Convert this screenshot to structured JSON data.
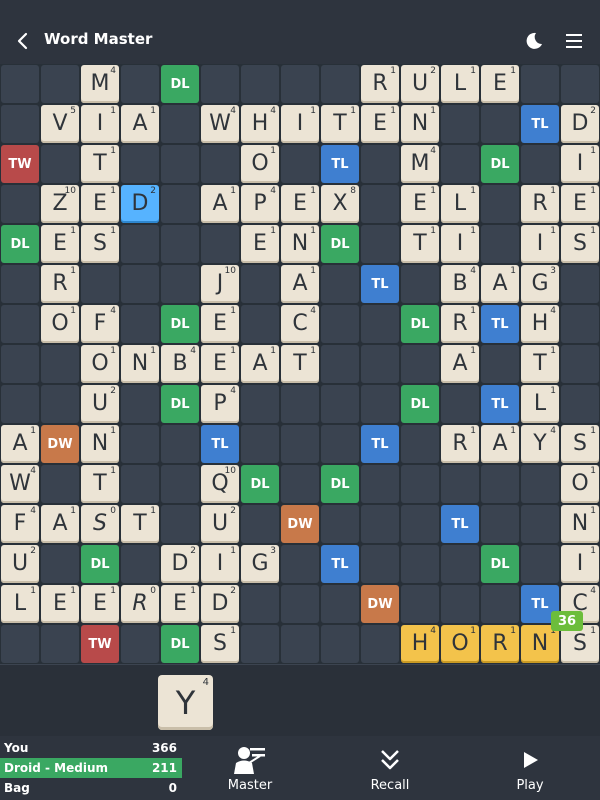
{
  "header": {
    "title": "Word Master",
    "back_icon": "chevron-left-icon",
    "theme_icon": "moon-icon",
    "menu_icon": "hamburger-menu-icon"
  },
  "board": {
    "size": 15,
    "colors": {
      "DL": "#3aa862",
      "TL": "#3f7fd0",
      "DW": "#c8794a",
      "TW": "#b84a4a",
      "tile": "#ece4d5",
      "new_tile": "#f3c34b",
      "last_tile": "#56b3ff",
      "empty": "#3a4350"
    },
    "tiles": [
      {
        "r": 0,
        "c": 2,
        "l": "M",
        "p": 4
      },
      {
        "r": 0,
        "c": 9,
        "l": "R",
        "p": 1
      },
      {
        "r": 0,
        "c": 10,
        "l": "U",
        "p": 2
      },
      {
        "r": 0,
        "c": 11,
        "l": "L",
        "p": 1
      },
      {
        "r": 0,
        "c": 12,
        "l": "E",
        "p": 1
      },
      {
        "r": 1,
        "c": 1,
        "l": "V",
        "p": 5
      },
      {
        "r": 1,
        "c": 2,
        "l": "I",
        "p": 1
      },
      {
        "r": 1,
        "c": 3,
        "l": "A",
        "p": 1
      },
      {
        "r": 1,
        "c": 5,
        "l": "W",
        "p": 4
      },
      {
        "r": 1,
        "c": 6,
        "l": "H",
        "p": 4
      },
      {
        "r": 1,
        "c": 7,
        "l": "I",
        "p": 1
      },
      {
        "r": 1,
        "c": 8,
        "l": "T",
        "p": 1
      },
      {
        "r": 1,
        "c": 9,
        "l": "E",
        "p": 1
      },
      {
        "r": 1,
        "c": 10,
        "l": "N",
        "p": 1
      },
      {
        "r": 1,
        "c": 14,
        "l": "D",
        "p": 2
      },
      {
        "r": 2,
        "c": 2,
        "l": "T",
        "p": 1
      },
      {
        "r": 2,
        "c": 6,
        "l": "O",
        "p": 1
      },
      {
        "r": 2,
        "c": 10,
        "l": "M",
        "p": 4
      },
      {
        "r": 2,
        "c": 14,
        "l": "I",
        "p": 1
      },
      {
        "r": 3,
        "c": 1,
        "l": "Z",
        "p": 10
      },
      {
        "r": 3,
        "c": 2,
        "l": "E",
        "p": 1
      },
      {
        "r": 3,
        "c": 3,
        "l": "D",
        "p": 2,
        "last": true
      },
      {
        "r": 3,
        "c": 5,
        "l": "A",
        "p": 1
      },
      {
        "r": 3,
        "c": 6,
        "l": "P",
        "p": 4
      },
      {
        "r": 3,
        "c": 7,
        "l": "E",
        "p": 1
      },
      {
        "r": 3,
        "c": 8,
        "l": "X",
        "p": 8
      },
      {
        "r": 3,
        "c": 10,
        "l": "E",
        "p": 1
      },
      {
        "r": 3,
        "c": 11,
        "l": "L",
        "p": 1
      },
      {
        "r": 3,
        "c": 13,
        "l": "R",
        "p": 1
      },
      {
        "r": 3,
        "c": 14,
        "l": "E",
        "p": 1
      },
      {
        "r": 4,
        "c": 1,
        "l": "E",
        "p": 1
      },
      {
        "r": 4,
        "c": 2,
        "l": "S",
        "p": 1
      },
      {
        "r": 4,
        "c": 6,
        "l": "E",
        "p": 1
      },
      {
        "r": 4,
        "c": 7,
        "l": "N",
        "p": 1
      },
      {
        "r": 4,
        "c": 10,
        "l": "T",
        "p": 1
      },
      {
        "r": 4,
        "c": 11,
        "l": "I",
        "p": 1
      },
      {
        "r": 4,
        "c": 13,
        "l": "I",
        "p": 1
      },
      {
        "r": 4,
        "c": 14,
        "l": "S",
        "p": 1
      },
      {
        "r": 5,
        "c": 1,
        "l": "R",
        "p": 1
      },
      {
        "r": 5,
        "c": 5,
        "l": "J",
        "p": 10
      },
      {
        "r": 5,
        "c": 7,
        "l": "A",
        "p": 1
      },
      {
        "r": 5,
        "c": 11,
        "l": "B",
        "p": 4
      },
      {
        "r": 5,
        "c": 12,
        "l": "A",
        "p": 1
      },
      {
        "r": 5,
        "c": 13,
        "l": "G",
        "p": 3
      },
      {
        "r": 6,
        "c": 1,
        "l": "O",
        "p": 1
      },
      {
        "r": 6,
        "c": 2,
        "l": "F",
        "p": 4
      },
      {
        "r": 6,
        "c": 5,
        "l": "E",
        "p": 1
      },
      {
        "r": 6,
        "c": 7,
        "l": "C",
        "p": 4
      },
      {
        "r": 6,
        "c": 11,
        "l": "R",
        "p": 1
      },
      {
        "r": 6,
        "c": 13,
        "l": "H",
        "p": 4
      },
      {
        "r": 7,
        "c": 2,
        "l": "O",
        "p": 1
      },
      {
        "r": 7,
        "c": 3,
        "l": "N",
        "p": 1
      },
      {
        "r": 7,
        "c": 4,
        "l": "B",
        "p": 4
      },
      {
        "r": 7,
        "c": 5,
        "l": "E",
        "p": 1
      },
      {
        "r": 7,
        "c": 6,
        "l": "A",
        "p": 1
      },
      {
        "r": 7,
        "c": 7,
        "l": "T",
        "p": 1
      },
      {
        "r": 7,
        "c": 11,
        "l": "A",
        "p": 1
      },
      {
        "r": 7,
        "c": 13,
        "l": "T",
        "p": 1
      },
      {
        "r": 8,
        "c": 2,
        "l": "U",
        "p": 2
      },
      {
        "r": 8,
        "c": 5,
        "l": "P",
        "p": 4
      },
      {
        "r": 8,
        "c": 13,
        "l": "L",
        "p": 1
      },
      {
        "r": 9,
        "c": 0,
        "l": "A",
        "p": 1
      },
      {
        "r": 9,
        "c": 2,
        "l": "N",
        "p": 1
      },
      {
        "r": 9,
        "c": 11,
        "l": "R",
        "p": 1
      },
      {
        "r": 9,
        "c": 12,
        "l": "A",
        "p": 1
      },
      {
        "r": 9,
        "c": 13,
        "l": "Y",
        "p": 4
      },
      {
        "r": 9,
        "c": 14,
        "l": "S",
        "p": 1
      },
      {
        "r": 10,
        "c": 0,
        "l": "W",
        "p": 4
      },
      {
        "r": 10,
        "c": 2,
        "l": "T",
        "p": 1
      },
      {
        "r": 10,
        "c": 5,
        "l": "Q",
        "p": 10
      },
      {
        "r": 10,
        "c": 14,
        "l": "O",
        "p": 1
      },
      {
        "r": 11,
        "c": 0,
        "l": "F",
        "p": 4
      },
      {
        "r": 11,
        "c": 1,
        "l": "A",
        "p": 1
      },
      {
        "r": 11,
        "c": 2,
        "l": "S",
        "p": 0,
        "blank": true
      },
      {
        "r": 11,
        "c": 3,
        "l": "T",
        "p": 1
      },
      {
        "r": 11,
        "c": 5,
        "l": "U",
        "p": 2
      },
      {
        "r": 11,
        "c": 14,
        "l": "N",
        "p": 1
      },
      {
        "r": 12,
        "c": 0,
        "l": "U",
        "p": 2
      },
      {
        "r": 12,
        "c": 4,
        "l": "D",
        "p": 2
      },
      {
        "r": 12,
        "c": 5,
        "l": "I",
        "p": 1
      },
      {
        "r": 12,
        "c": 6,
        "l": "G",
        "p": 3
      },
      {
        "r": 12,
        "c": 14,
        "l": "I",
        "p": 1
      },
      {
        "r": 13,
        "c": 0,
        "l": "L",
        "p": 1
      },
      {
        "r": 13,
        "c": 1,
        "l": "E",
        "p": 1
      },
      {
        "r": 13,
        "c": 2,
        "l": "E",
        "p": 1
      },
      {
        "r": 13,
        "c": 3,
        "l": "R",
        "p": 0,
        "blank": true
      },
      {
        "r": 13,
        "c": 4,
        "l": "E",
        "p": 1
      },
      {
        "r": 13,
        "c": 5,
        "l": "D",
        "p": 2
      },
      {
        "r": 13,
        "c": 14,
        "l": "C",
        "p": 4
      },
      {
        "r": 14,
        "c": 5,
        "l": "S",
        "p": 1
      },
      {
        "r": 14,
        "c": 10,
        "l": "H",
        "p": 4,
        "new": true
      },
      {
        "r": 14,
        "c": 11,
        "l": "O",
        "p": 1,
        "new": true
      },
      {
        "r": 14,
        "c": 12,
        "l": "R",
        "p": 1,
        "new": true
      },
      {
        "r": 14,
        "c": 13,
        "l": "N",
        "p": 1,
        "new": true
      },
      {
        "r": 14,
        "c": 14,
        "l": "S",
        "p": 1
      }
    ],
    "bonuses": [
      {
        "r": 0,
        "c": 4,
        "t": "DL"
      },
      {
        "r": 1,
        "c": 13,
        "t": "TL"
      },
      {
        "r": 2,
        "c": 0,
        "t": "TW"
      },
      {
        "r": 2,
        "c": 8,
        "t": "TL"
      },
      {
        "r": 2,
        "c": 12,
        "t": "DL"
      },
      {
        "r": 4,
        "c": 0,
        "t": "DL"
      },
      {
        "r": 4,
        "c": 8,
        "t": "DL"
      },
      {
        "r": 5,
        "c": 9,
        "t": "TL"
      },
      {
        "r": 6,
        "c": 4,
        "t": "DL"
      },
      {
        "r": 6,
        "c": 10,
        "t": "DL"
      },
      {
        "r": 6,
        "c": 12,
        "t": "TL"
      },
      {
        "r": 8,
        "c": 4,
        "t": "DL"
      },
      {
        "r": 8,
        "c": 10,
        "t": "DL"
      },
      {
        "r": 8,
        "c": 12,
        "t": "TL"
      },
      {
        "r": 9,
        "c": 1,
        "t": "DW"
      },
      {
        "r": 9,
        "c": 5,
        "t": "TL"
      },
      {
        "r": 9,
        "c": 9,
        "t": "TL"
      },
      {
        "r": 10,
        "c": 6,
        "t": "DL"
      },
      {
        "r": 10,
        "c": 8,
        "t": "DL"
      },
      {
        "r": 11,
        "c": 7,
        "t": "DW"
      },
      {
        "r": 11,
        "c": 11,
        "t": "TL"
      },
      {
        "r": 12,
        "c": 2,
        "t": "DL"
      },
      {
        "r": 12,
        "c": 8,
        "t": "TL"
      },
      {
        "r": 12,
        "c": 12,
        "t": "DL"
      },
      {
        "r": 13,
        "c": 9,
        "t": "DW"
      },
      {
        "r": 13,
        "c": 13,
        "t": "TL"
      },
      {
        "r": 14,
        "c": 2,
        "t": "TW"
      },
      {
        "r": 14,
        "c": 4,
        "t": "DL"
      }
    ],
    "move_score": "36"
  },
  "rack": {
    "tiles": [
      {
        "l": "Y",
        "p": 4
      }
    ]
  },
  "scores": [
    {
      "name": "You",
      "score": "366",
      "active": false
    },
    {
      "name": "Droid - Medium",
      "score": "211",
      "active": true
    },
    {
      "name": "Bag",
      "score": "0",
      "active": false
    }
  ],
  "actions": {
    "master": {
      "label": "Master",
      "icon": "coach-master-icon"
    },
    "recall": {
      "label": "Recall",
      "icon": "chevrons-down-icon"
    },
    "play": {
      "label": "Play",
      "icon": "play-triangle-icon"
    }
  }
}
